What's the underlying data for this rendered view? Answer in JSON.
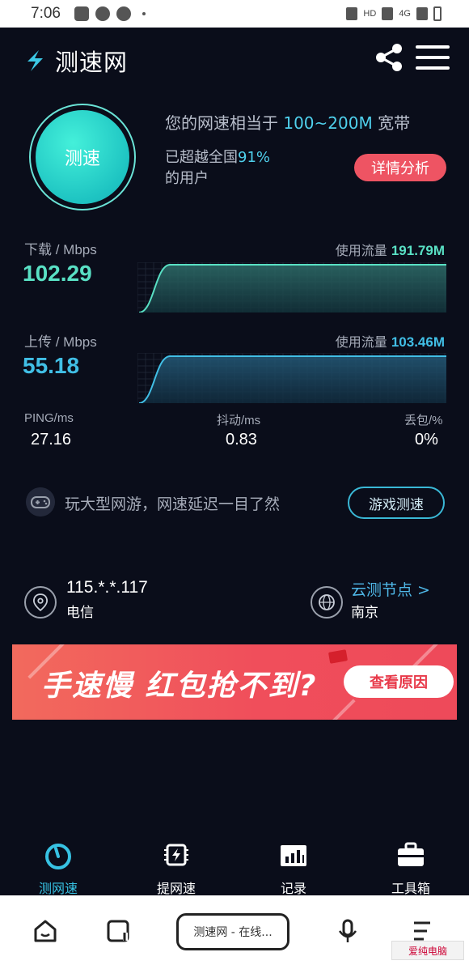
{
  "status_bar": {
    "time": "7:06",
    "network": "HD",
    "signal": "4G"
  },
  "header": {
    "app_name": "测速网"
  },
  "speed_test": {
    "button_label": "测速",
    "summary_prefix": "您的网速相当于",
    "summary_range": "100~200M",
    "summary_suffix": "宽带",
    "surpass_prefix": "已超越全国",
    "surpass_percent": "91%",
    "surpass_suffix": "的用户",
    "detail_button": "详情分析"
  },
  "download": {
    "label": "下载 / Mbps",
    "value": "102.29",
    "usage_label": "使用流量",
    "usage_value": "191.79M",
    "color": "#59e0c4"
  },
  "upload": {
    "label": "上传 / Mbps",
    "value": "55.18",
    "usage_label": "使用流量",
    "usage_value": "103.46M",
    "color": "#41bfe6"
  },
  "stats": {
    "ping_label": "PING/ms",
    "ping_value": "27.16",
    "jitter_label": "抖动/ms",
    "jitter_value": "0.83",
    "loss_label": "丢包/%",
    "loss_value": "0%"
  },
  "game": {
    "text": "玩大型网游，网速延迟一目了然",
    "button": "游戏测速"
  },
  "location": {
    "ip": "115.*.*.117",
    "isp": "电信",
    "node_link": "云测节点 >",
    "node_city": "南京"
  },
  "banner": {
    "text": "手速慢 红包抢不到?",
    "button": "查看原因"
  },
  "bottom_nav": {
    "items": [
      {
        "label": "测网速",
        "icon": "speedometer-icon"
      },
      {
        "label": "提网速",
        "icon": "chip-boost-icon"
      },
      {
        "label": "记录",
        "icon": "records-chart-icon"
      },
      {
        "label": "工具箱",
        "icon": "toolbox-icon"
      }
    ]
  },
  "system_bar": {
    "tab_title": "测速网 - 在线..."
  },
  "watermark": {
    "text": "爱纯电脑"
  },
  "colors": {
    "background": "#0a0d1a",
    "accent_cyan": "#37c2e3",
    "accent_red": "#ee5463"
  }
}
